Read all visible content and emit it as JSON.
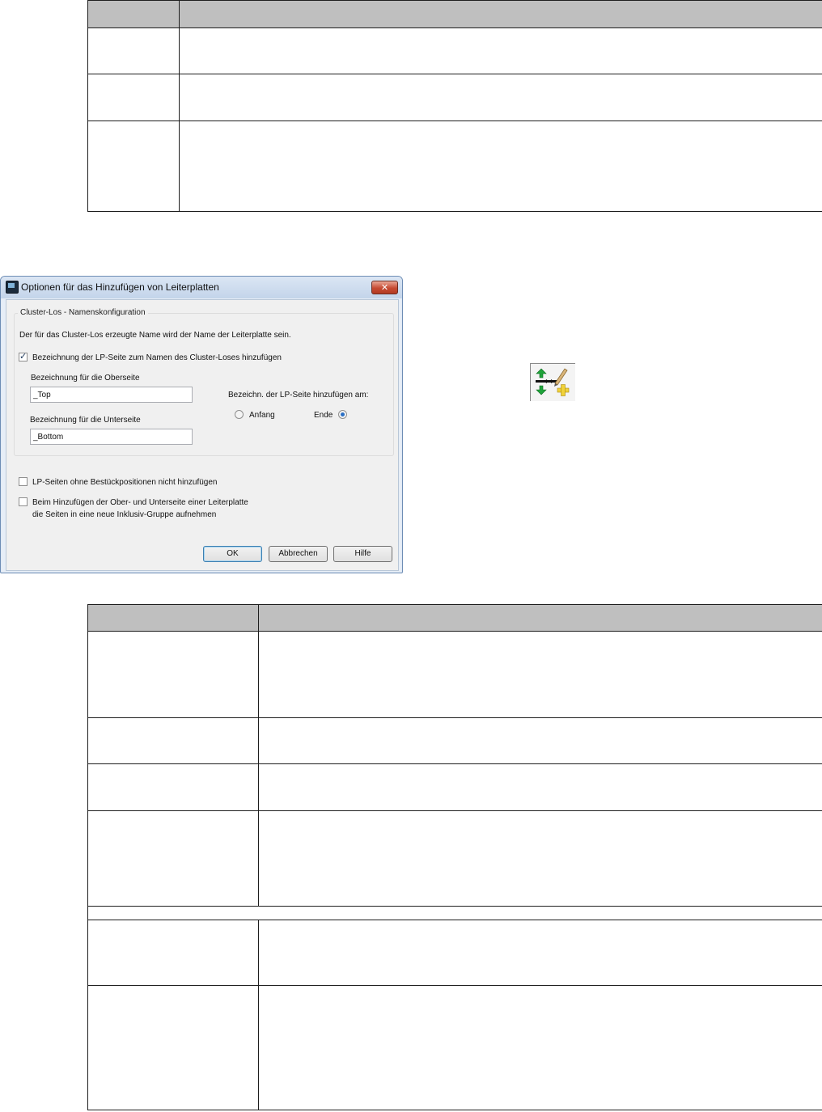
{
  "dialog": {
    "title": "Optionen für das Hinzufügen von Leiterplatten",
    "close_label": "✕",
    "group_caption": "Cluster-Los - Namenskonfiguration",
    "info_text": "Der für das Cluster-Los erzeugte Name wird der Name der Leiterplatte sein.",
    "add_side_label": "Bezeichnung der LP-Seite zum Namen des Cluster-Loses hinzufügen",
    "top_label": "Bezeichnung für die Oberseite",
    "top_value": "_Top",
    "bottom_label": "Bezeichnung für die Unterseite",
    "bottom_value": "_Bottom",
    "position_label": "Bezeichn. der LP-Seite hinzufügen am:",
    "radio_start": "Anfang",
    "radio_end": "Ende",
    "no_empty_sides_label": "LP-Seiten ohne Bestückpositionen nicht hinzufügen",
    "inclusive_group_line1": "Beim Hinzufügen der Ober- und Unterseite einer Leiterplatte",
    "inclusive_group_line2": "die Seiten in eine neue Inklusiv-Gruppe aufnehmen",
    "ok": "OK",
    "cancel": "Abbrechen",
    "help": "Hilfe"
  },
  "checkbox_states": {
    "add_side": true,
    "no_empty_sides": false,
    "inclusive_group": false
  },
  "radio_selected": "Ende",
  "toolbar_icon": "add-boards-options-icon"
}
